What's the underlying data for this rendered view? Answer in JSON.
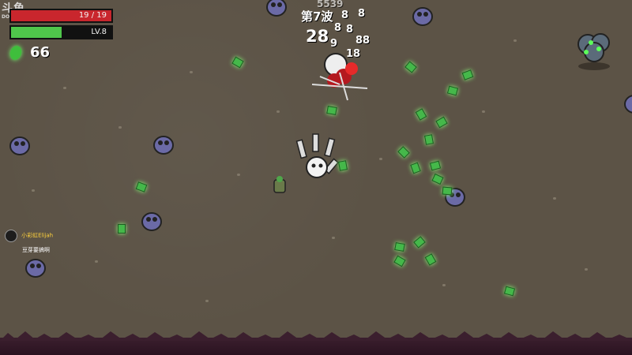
{
  "watermark": {
    "line1": "斗鱼",
    "line2": "DOUYU.COM"
  },
  "hud": {
    "health_text": "19 / 19",
    "health_fraction": 1.0,
    "level_text": "LV.8",
    "xp_fraction": 0.5,
    "materials_count": "66"
  },
  "wave": {
    "label": "第7波",
    "timer": "28"
  },
  "damage_numbers": [
    "5539",
    "8",
    "8",
    "8",
    "8",
    "9",
    "88",
    "18"
  ],
  "chat": {
    "username": "小彩虹Elijah",
    "message": "豆芽要搞啊"
  },
  "colors": {
    "ground": "#5c5346",
    "health": "#c9262d",
    "xp": "#4fc64b",
    "alien": "#6b6aa6",
    "material": "#45b84a",
    "grass": "#3b1f2e"
  }
}
